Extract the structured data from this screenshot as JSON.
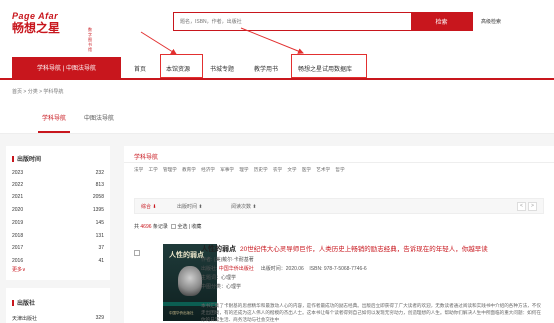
{
  "header": {
    "logo_en": "Page Afar",
    "logo_cn": "畅想之星",
    "logo_sub_1": "数字",
    "logo_sub_2": "图书馆",
    "search_placeholder": "题名，ISBN，作者，出版社",
    "search_button": "检索",
    "advanced": "高级检索"
  },
  "nav": {
    "primary": "学科导航 | 中图法导航",
    "items": [
      "首页",
      "本馆资源",
      "书城专题",
      "教学用书",
      "畅想之星试用数据库"
    ]
  },
  "breadcrumb": "首页 > 分类 > 学科导航",
  "tabs": [
    "学科导航",
    "中图法导航"
  ],
  "sidebar": {
    "year_title": "出版时间",
    "years": [
      {
        "year": "2023",
        "count": "232"
      },
      {
        "year": "2022",
        "count": "813"
      },
      {
        "year": "2021",
        "count": "2058"
      },
      {
        "year": "2020",
        "count": "1395"
      },
      {
        "year": "2019",
        "count": "145"
      },
      {
        "year": "2018",
        "count": "131"
      },
      {
        "year": "2017",
        "count": "37"
      },
      {
        "year": "2016",
        "count": "41"
      }
    ],
    "more": "更多∨",
    "publisher_title": "出版社",
    "publisher_first": "天津出版社",
    "publisher_first_count": "329"
  },
  "main": {
    "title": "学科导航",
    "subjects": [
      "法学",
      "工学",
      "管理学",
      "教育学",
      "经济学",
      "军事学",
      "理学",
      "历史学",
      "农学",
      "文学",
      "医学",
      "艺术学",
      "哲学"
    ],
    "sort": [
      "综合",
      "出版时间",
      "阅读次数"
    ],
    "pager": [
      "<",
      ">"
    ],
    "count_prefix": "共",
    "count_value": "4696",
    "count_suffix": "条记录",
    "select_all": "全选",
    "favorite": "收藏"
  },
  "book": {
    "cover_title": "人性的弱点",
    "cover_pub": "中国华侨出版社",
    "title": "人性的弱点",
    "tagline": "20世纪伟大心灵导师巨作，人类历史上畅销的励志经典，告诉现在的年轻人，你越早读",
    "author_label": "作者:",
    "author": "(美)戴尔·卡耐基著",
    "publisher_label": "出版社:",
    "publisher": "中国华侨出版社",
    "date_label": "出版时间：",
    "date": "2020.06",
    "isbn_label": "ISBN:",
    "isbn": "978-7-5068-7746-6",
    "subject_label": "主题词：",
    "subject": "心理学",
    "category_label": "中图分类：",
    "category": "心理学",
    "desc": "本书汇集了卡耐基的思想精华和最激动人心的内容，是作者最成功的励志经典。出版后立即获得了广大读者的欢迎，无数读者通过阅读和实践书中介绍的各种方法，不仅走出困境，有的还成为这人伟人的楷模的杰出人士。这本书让每个读者得到自己如何以发现无穷动力，创造理想的人生。帮助你们解决人生中所面临的重大问题：如何在你的日常生活、商务活动与社会交往中"
  }
}
